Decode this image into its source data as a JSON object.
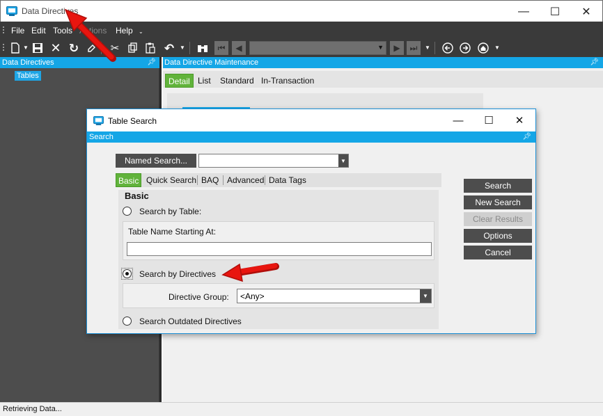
{
  "window": {
    "title": "Data Directives",
    "controls": {
      "minimize": "—",
      "maximize": "☐",
      "close": "✕"
    }
  },
  "menu": {
    "items": [
      "File",
      "Edit",
      "Tools",
      "Actions",
      "Help"
    ],
    "help_caret": "⌄"
  },
  "left_pane": {
    "header": "Data Directives",
    "tree": [
      "Tables"
    ]
  },
  "right_pane": {
    "header": "Data Directive Maintenance",
    "tabs": [
      "Detail",
      "List",
      "Standard",
      "In-Transaction"
    ]
  },
  "status": "Retrieving Data...",
  "dialog": {
    "title": "Table Search",
    "header": "Search",
    "named_search_label": "Named Search...",
    "named_search_value": "",
    "subtabs": [
      "Basic",
      "Quick Search",
      "BAQ",
      "Advanced",
      "Data Tags"
    ],
    "basic": {
      "title": "Basic",
      "search_by_table": "Search by Table:",
      "table_name_label": "Table Name Starting At:",
      "table_name_value": "",
      "search_by_directives": "Search by Directives",
      "directive_group_label": "Directive Group:",
      "directive_group_value": "<Any>",
      "search_outdated": "Search Outdated Directives",
      "selected": "search_by_directives"
    },
    "buttons": {
      "search": "Search",
      "new_search": "New Search",
      "clear_results": "Clear Results",
      "options": "Options",
      "cancel": "Cancel"
    }
  },
  "colors": {
    "accent_blue": "#14a6e6",
    "tab_green": "#61b33b",
    "toolbar_dark": "#3a3a3a",
    "annotation_red": "#e8150f"
  },
  "icons": [
    "new-icon",
    "save-icon",
    "delete-icon",
    "refresh-icon",
    "clear-icon",
    "cut-icon",
    "copy-icon",
    "paste-icon",
    "undo-icon",
    "binoculars-icon",
    "first-icon",
    "prev-icon",
    "next-icon",
    "last-icon",
    "back-icon",
    "forward-icon",
    "home-icon"
  ]
}
